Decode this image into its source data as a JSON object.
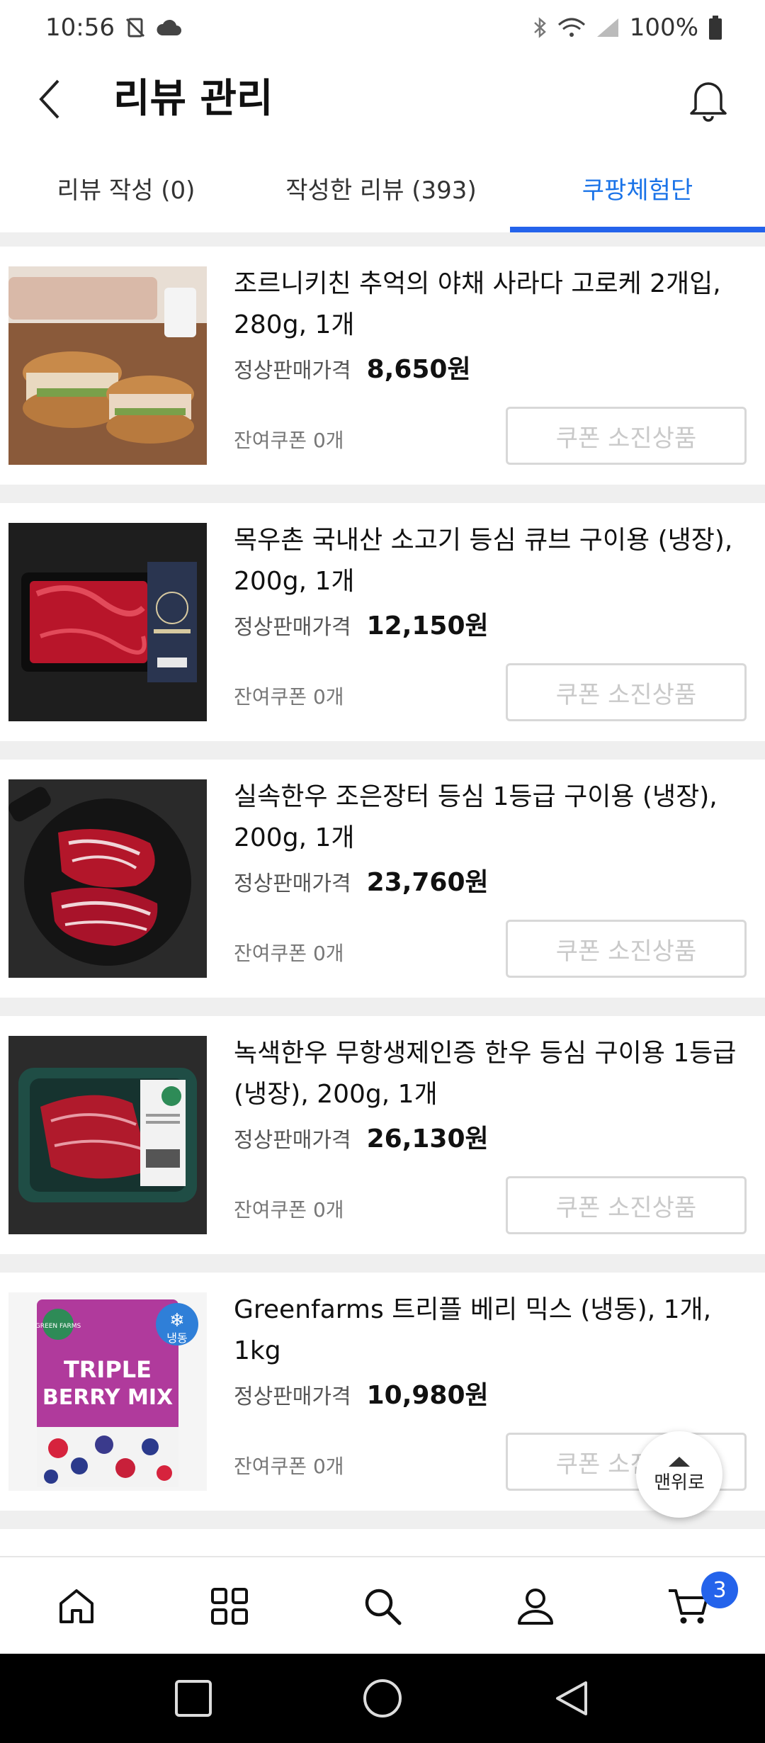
{
  "status_bar": {
    "time": "10:56",
    "battery": "100%",
    "icons": [
      "no-sim-icon",
      "cloud-icon",
      "bluetooth-icon",
      "wifi-icon",
      "signal-icon",
      "battery-icon"
    ]
  },
  "header": {
    "title": "리뷰 관리",
    "back_icon": "chevron-left-icon",
    "bell_icon": "bell-icon"
  },
  "tabs": [
    {
      "label": "리뷰 작성 (0)",
      "active": false
    },
    {
      "label": "작성한 리뷰 (393)",
      "active": false
    },
    {
      "label": "쿠팡체험단",
      "active": true
    }
  ],
  "products": [
    {
      "name": "조르니키친 추억의 야채 사라다 고로케 2개입, 280g, 1개",
      "price_label": "정상판매가격",
      "price": "8,650원",
      "remain": "잔여쿠폰 0개",
      "button": "쿠폰 소진상품"
    },
    {
      "name": "목우촌 국내산 소고기 등심 큐브 구이용 (냉장), 200g, 1개",
      "price_label": "정상판매가격",
      "price": "12,150원",
      "remain": "잔여쿠폰 0개",
      "button": "쿠폰 소진상품"
    },
    {
      "name": "실속한우 조은장터 등심 1등급 구이용 (냉장), 200g, 1개",
      "price_label": "정상판매가격",
      "price": "23,760원",
      "remain": "잔여쿠폰 0개",
      "button": "쿠폰 소진상품"
    },
    {
      "name": "녹색한우 무항생제인증 한우 등심 구이용 1등급 (냉장), 200g, 1개",
      "price_label": "정상판매가격",
      "price": "26,130원",
      "remain": "잔여쿠폰 0개",
      "button": "쿠폰 소진상품"
    },
    {
      "name": "Greenfarms 트리플 베리 믹스 (냉동), 1개, 1kg",
      "price_label": "정상판매가격",
      "price": "10,980원",
      "remain": "잔여쿠폰 0개",
      "button": "쿠폰 소진상품"
    }
  ],
  "thumb_text": {
    "berry_title_1": "TRIPLE",
    "berry_title_2": "BERRY MIX",
    "berry_frozen": "냉동",
    "berry_brand": "GREEN FARMS"
  },
  "scroll_top_label": "맨위로",
  "bottom_nav": {
    "items": [
      "home-icon",
      "grid-icon",
      "search-icon",
      "user-icon",
      "cart-icon"
    ],
    "cart_badge": "3"
  },
  "colors": {
    "accent": "#2463eb",
    "divider": "#efefef",
    "disabled_text": "#c9c9c9"
  }
}
